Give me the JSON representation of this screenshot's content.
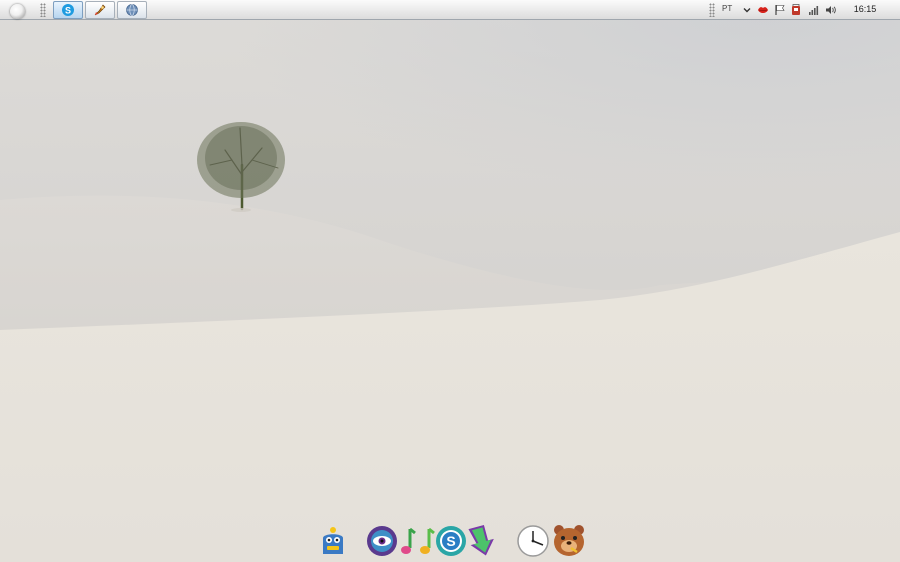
{
  "taskbar": {
    "tasks": [
      {
        "icon": "skype-icon",
        "active": true
      },
      {
        "icon": "rocket-launcher-icon",
        "active": false
      },
      {
        "icon": "browser-globe-icon",
        "active": false
      }
    ],
    "tray": {
      "language": "PT",
      "clock": "16:15",
      "icons": [
        "chevron-down-icon",
        "lips-icon",
        "flag-icon",
        "security-icon",
        "network-signal-icon",
        "volume-icon"
      ]
    }
  },
  "dock": {
    "icons": [
      "monster-icon",
      "eye-spiral-icon",
      "music-note-icon",
      "music-note-alt-icon",
      "skype-dock-icon",
      "download-arrow-icon",
      "clock-icon",
      "bear-icon"
    ]
  },
  "colors": {
    "sky": "#d9d7d4",
    "snow": "#e8e5df",
    "taskbar": "#ebebeb"
  }
}
